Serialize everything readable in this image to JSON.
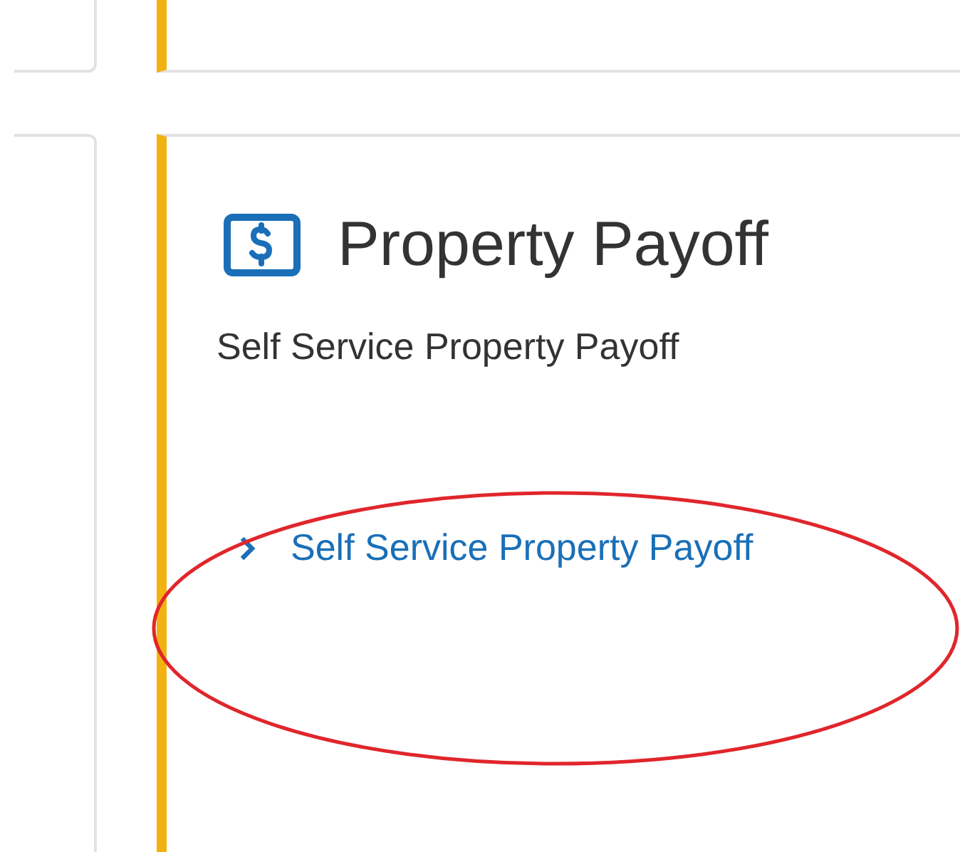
{
  "card": {
    "title": "Property Payoff",
    "description": "Self Service Property Payoff",
    "links": [
      {
        "label": "Self Service Property Payoff"
      }
    ]
  }
}
